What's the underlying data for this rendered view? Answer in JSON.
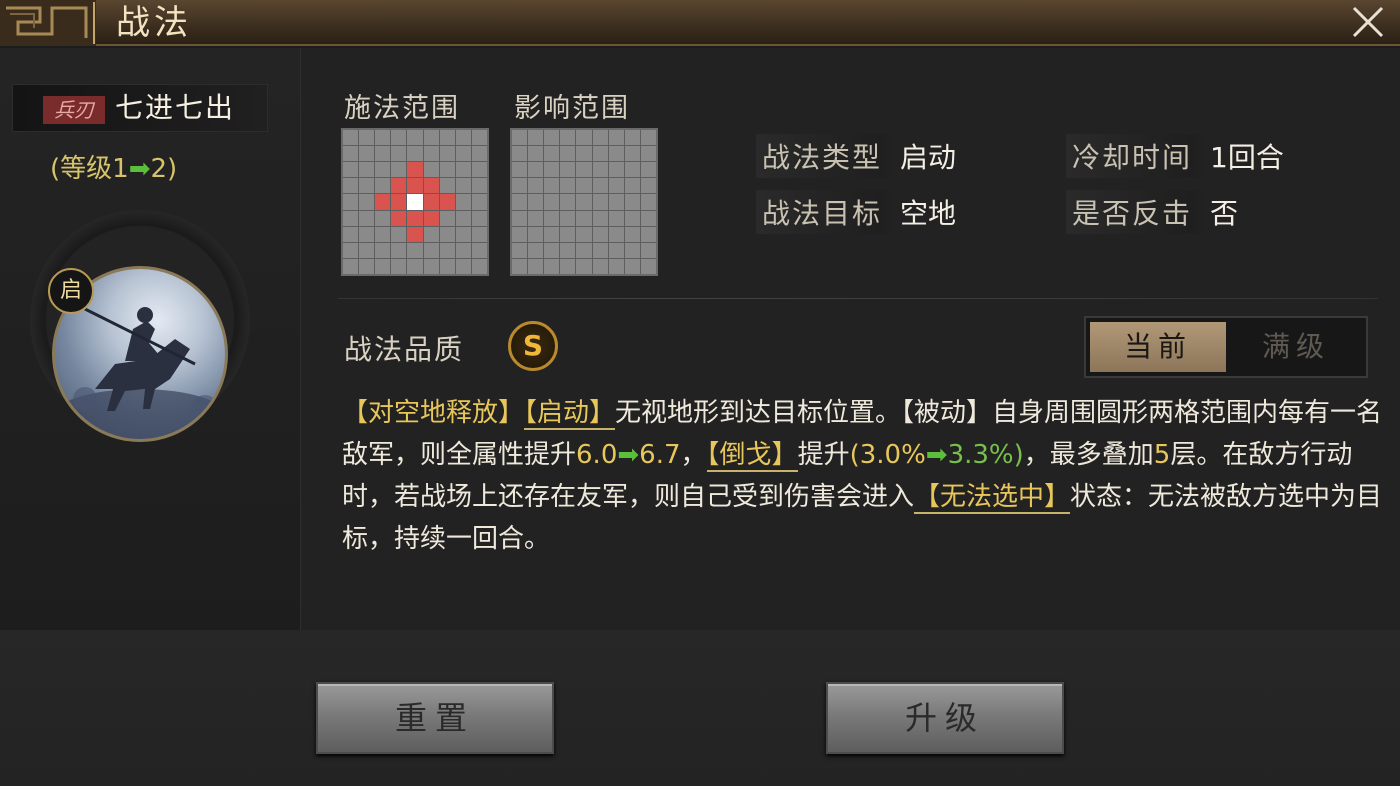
{
  "window": {
    "title": "战法",
    "close_icon": "close-icon"
  },
  "skill": {
    "weapon_tag": "兵刃",
    "name": "七进七出",
    "level_prefix": "(等级1",
    "level_suffix": "2)",
    "level_arrow": "➡",
    "type_badge": "启"
  },
  "ranges": {
    "cast_label": "施法范围",
    "effect_label": "影响范围",
    "grid_size": 9,
    "cast_hit_cells": [
      [
        2,
        4
      ],
      [
        3,
        3
      ],
      [
        3,
        4
      ],
      [
        3,
        5
      ],
      [
        4,
        2
      ],
      [
        4,
        3
      ],
      [
        4,
        5
      ],
      [
        4,
        6
      ],
      [
        5,
        3
      ],
      [
        5,
        4
      ],
      [
        5,
        5
      ],
      [
        6,
        4
      ]
    ],
    "cast_center_cell": [
      4,
      4
    ],
    "effect_hit_cells": []
  },
  "attributes": [
    {
      "key": "战法类型",
      "value": "启动"
    },
    {
      "key": "冷却时间",
      "value": "1回合"
    },
    {
      "key": "战法目标",
      "value": "空地"
    },
    {
      "key": "是否反击",
      "value": "否"
    }
  ],
  "quality": {
    "label": "战法品质",
    "grade": "S"
  },
  "toggle": {
    "current": "当前",
    "max": "满级"
  },
  "description": {
    "p1": "【对空地释放】",
    "p2": "【启动】",
    "p3": "无视地形到达目标位置。【被动】自身周围圆形两格范围内每有一名敌军，则全属性提升",
    "p4": "6.0",
    "p5": "6.7",
    "p6": "，",
    "p7": "【倒戈】",
    "p8": "提升",
    "p9": "(3.0%",
    "p10": "3.3%)",
    "p11": "，最多叠加",
    "p12": "5",
    "p13": "层。在敌方行动时，若战场上还存在友军，则自己受到伤害会进入",
    "p14": "【无法选中】",
    "p15": "状态：无法被敌方选中为目标，持续一回合。",
    "arrow": "➡"
  },
  "buttons": {
    "reset": "重置",
    "upgrade": "升级"
  },
  "colors": {
    "hit_cell": "#d9534f",
    "center_cell": "#ffffff",
    "gold_text": "#e8c75a",
    "green_arrow": "#5bbf3a",
    "quality_s": "#f0b73a"
  }
}
